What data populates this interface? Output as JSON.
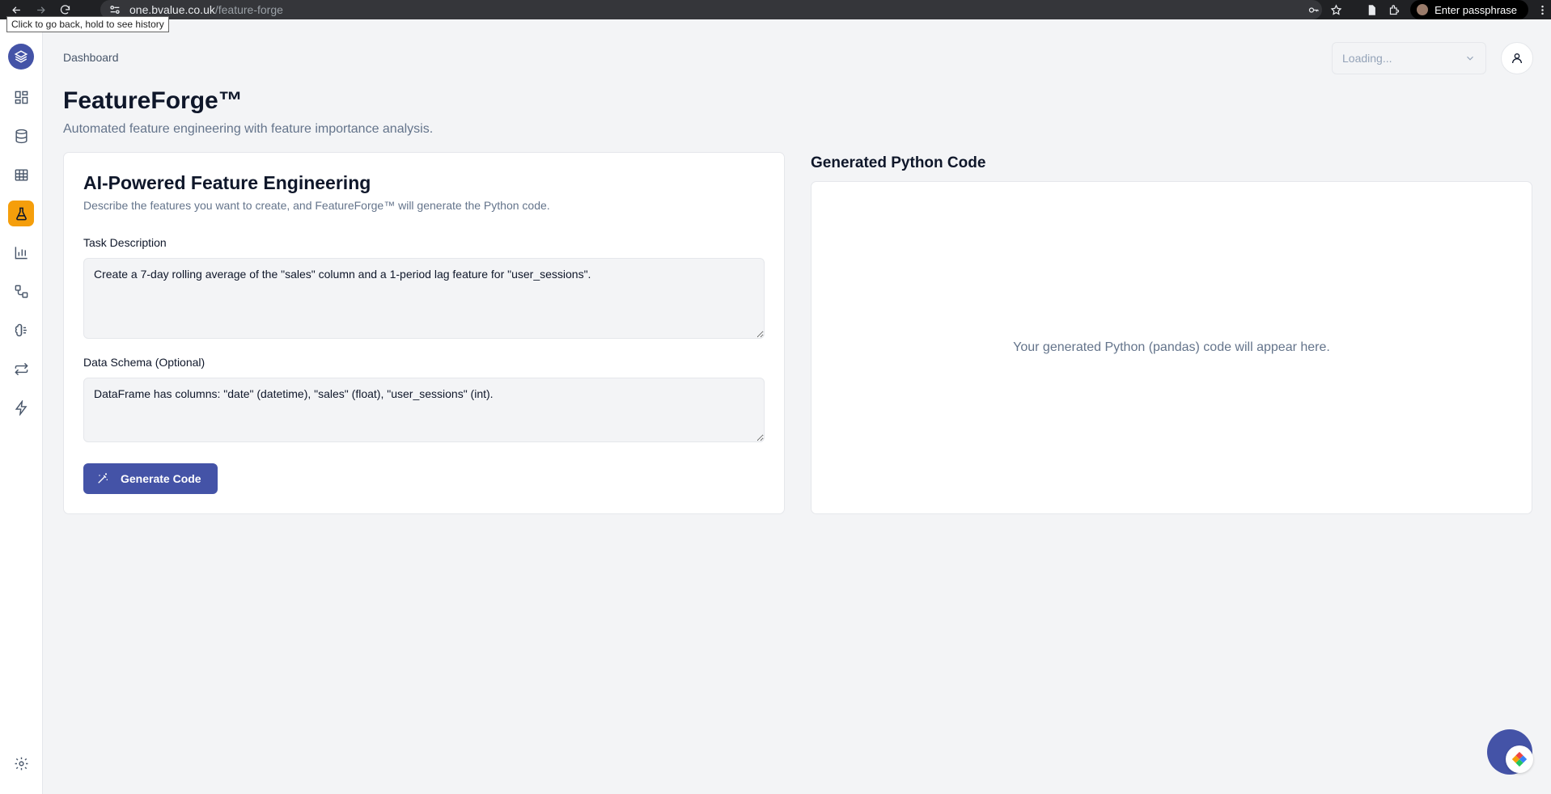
{
  "browser": {
    "url_host": "one.bvalue.co.uk",
    "url_path": "/feature-forge",
    "tooltip": "Click to go back, hold to see history",
    "passphrase_label": "Enter passphrase"
  },
  "header": {
    "breadcrumb": "Dashboard",
    "project_select": "Loading..."
  },
  "page": {
    "title": "FeatureForge™",
    "subtitle": "Automated feature engineering with feature importance analysis."
  },
  "form": {
    "title": "AI-Powered Feature Engineering",
    "description": "Describe the features you want to create, and FeatureForge™ will generate the Python code.",
    "task_label": "Task Description",
    "task_value": "Create a 7-day rolling average of the \"sales\" column and a 1-period lag feature for \"user_sessions\".",
    "schema_label": "Data Schema (Optional)",
    "schema_value": "DataFrame has columns: \"date\" (datetime), \"sales\" (float), \"user_sessions\" (int).",
    "generate_label": "Generate Code"
  },
  "output": {
    "title": "Generated Python Code",
    "placeholder": "Your generated Python (pandas) code will appear here."
  },
  "colors": {
    "primary": "#4453a7",
    "active_nav": "#f59e0b",
    "background": "#f3f4f6"
  },
  "sidebar": {
    "items": [
      {
        "icon": "dashboard-grid-icon"
      },
      {
        "icon": "database-icon"
      },
      {
        "icon": "table-icon"
      },
      {
        "icon": "flask-icon",
        "active": true
      },
      {
        "icon": "bar-chart-icon"
      },
      {
        "icon": "workflow-icon"
      },
      {
        "icon": "brain-icon"
      },
      {
        "icon": "swap-icon"
      },
      {
        "icon": "lightning-icon"
      }
    ]
  }
}
